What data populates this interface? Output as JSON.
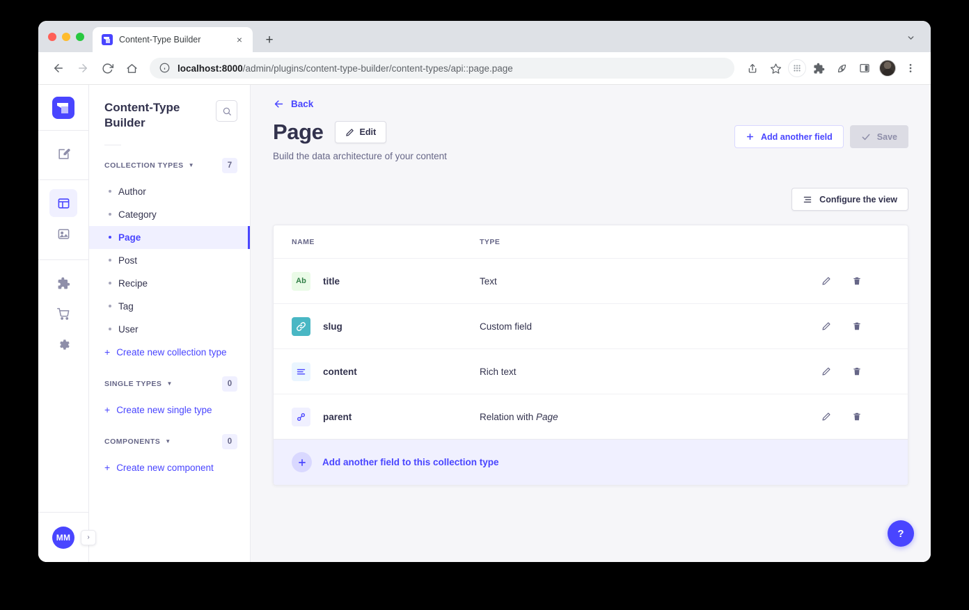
{
  "browser": {
    "tab": {
      "title": "Content-Type Builder",
      "favicon": "strapi-logo-icon",
      "close": "×"
    },
    "new_tab_label": "+",
    "url_bold": "localhost:8000",
    "url_rest": "/admin/plugins/content-type-builder/content-types/api::page.page",
    "back_icon": "back-arrow-icon",
    "forward_icon": "forward-arrow-icon",
    "reload_icon": "reload-icon",
    "home_icon": "home-icon",
    "info_icon": "info-circle-icon",
    "share_icon": "share-icon",
    "bookmark_icon": "star-icon",
    "extensions_icon": "puzzle-icon",
    "profile_icon": "profile-avatar-icon",
    "menu_icon": "kebab-menu-icon"
  },
  "rail": {
    "logo": "strapi-logo",
    "items": [
      {
        "name": "content-manager",
        "icon": "pencil-square-icon",
        "active": false
      },
      {
        "name": "content-type-builder",
        "icon": "layout-icon",
        "active": true
      },
      {
        "name": "media-library",
        "icon": "image-icon",
        "active": false
      },
      {
        "name": "plugins",
        "icon": "puzzle-icon",
        "active": false
      },
      {
        "name": "marketplace",
        "icon": "shopping-cart-icon",
        "active": false
      },
      {
        "name": "settings",
        "icon": "gear-icon",
        "active": false
      }
    ],
    "avatar_initials": "MM",
    "expand_icon": "›"
  },
  "sidebar": {
    "title": "Content-Type Builder",
    "search_icon": "search-icon",
    "sections": [
      {
        "label": "COLLECTION TYPES",
        "count": "7",
        "items": [
          {
            "label": "Author",
            "active": false
          },
          {
            "label": "Category",
            "active": false
          },
          {
            "label": "Page",
            "active": true
          },
          {
            "label": "Post",
            "active": false
          },
          {
            "label": "Recipe",
            "active": false
          },
          {
            "label": "Tag",
            "active": false
          },
          {
            "label": "User",
            "active": false
          }
        ],
        "create_label": "Create new collection type"
      },
      {
        "label": "SINGLE TYPES",
        "count": "0",
        "items": [],
        "create_label": "Create new single type"
      },
      {
        "label": "COMPONENTS",
        "count": "0",
        "items": [],
        "create_label": "Create new component"
      }
    ]
  },
  "main": {
    "back_label": "Back",
    "title": "Page",
    "edit_label": "Edit",
    "subtitle": "Build the data architecture of your content",
    "add_field_label": "Add another field",
    "save_label": "Save",
    "configure_label": "Configure the view",
    "table": {
      "headers": {
        "name": "NAME",
        "type": "TYPE"
      },
      "rows": [
        {
          "icon_label": "Ab",
          "icon_kind": "text",
          "icon_name": "text-field-icon",
          "name": "title",
          "type": "Text",
          "type_italic": ""
        },
        {
          "icon_label": "",
          "icon_kind": "custom",
          "icon_name": "custom-field-link-icon",
          "name": "slug",
          "type": "Custom field",
          "type_italic": ""
        },
        {
          "icon_label": "",
          "icon_kind": "rich",
          "icon_name": "rich-text-icon",
          "name": "content",
          "type": "Rich text",
          "type_italic": ""
        },
        {
          "icon_label": "",
          "icon_kind": "relation",
          "icon_name": "relation-link-icon",
          "name": "parent",
          "type": "Relation with ",
          "type_italic": "Page"
        }
      ],
      "edit_icon": "pencil-icon",
      "delete_icon": "trash-icon"
    },
    "footer_label": "Add another field to this collection type",
    "help_label": "?"
  },
  "colors": {
    "primary": "#4945ff",
    "primary_light": "#f0f0ff",
    "text": "#32324d",
    "muted": "#666687",
    "bg": "#f6f6f9",
    "green": "#328048",
    "teal": "#49b7c4"
  }
}
